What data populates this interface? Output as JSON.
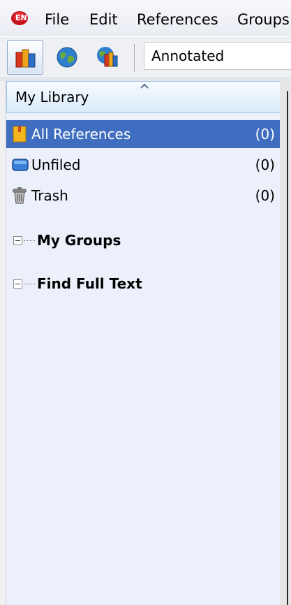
{
  "menu": {
    "items": [
      "File",
      "Edit",
      "References",
      "Groups"
    ]
  },
  "toolbar": {
    "buttons": [
      {
        "icon": "local-library-icon",
        "active": true
      },
      {
        "icon": "online-search-icon",
        "active": false
      },
      {
        "icon": "integrated-library-icon",
        "active": false
      }
    ],
    "output_style": "Annotated"
  },
  "panel": {
    "header": "My Library",
    "items": [
      {
        "label": "All References",
        "count": "(0)",
        "icon": "all-references-icon",
        "selected": true
      },
      {
        "label": "Unfiled",
        "count": "(0)",
        "icon": "unfiled-folder-icon",
        "selected": false
      },
      {
        "label": "Trash",
        "count": "(0)",
        "icon": "trash-icon",
        "selected": false
      }
    ],
    "groups": [
      {
        "label": "My Groups",
        "icon": "collapse-toggle-icon"
      },
      {
        "label": "Find Full Text",
        "icon": "collapse-toggle-icon"
      }
    ]
  },
  "colors": {
    "selection": "#3f6dbf",
    "panel_bg": "#ecf0fa",
    "header_border": "#9fc3e6"
  }
}
